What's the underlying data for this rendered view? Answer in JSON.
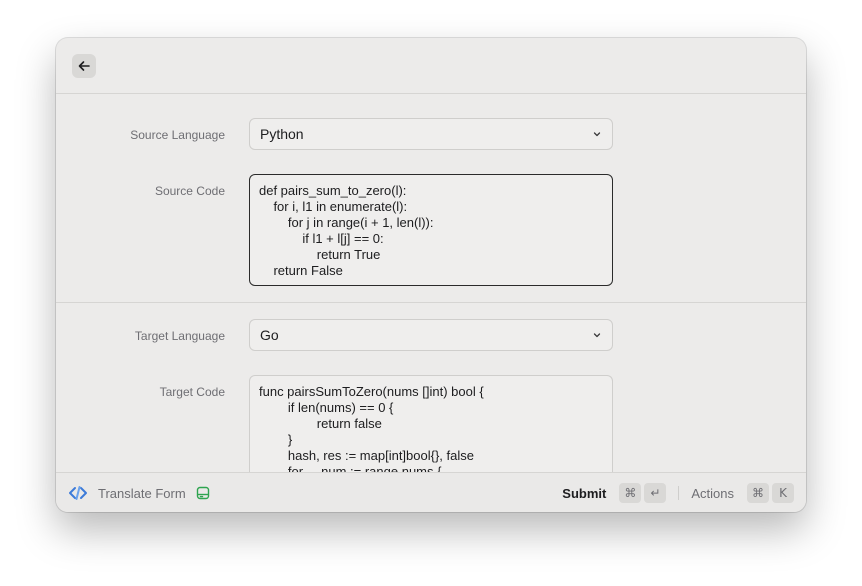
{
  "window": {
    "title": "Translate Form"
  },
  "form": {
    "source_language": {
      "label": "Source Language",
      "value": "Python"
    },
    "source_code": {
      "label": "Source Code",
      "value": "def pairs_sum_to_zero(l):\n    for i, l1 in enumerate(l):\n        for j in range(i + 1, len(l)):\n            if l1 + l[j] == 0:\n                return True\n    return False"
    },
    "target_language": {
      "label": "Target Language",
      "value": "Go"
    },
    "target_code": {
      "label": "Target Code",
      "value": "func pairsSumToZero(nums []int) bool {\n        if len(nums) == 0 {\n                return false\n        }\n        hash, res := map[int]bool{}, false\n        for _, num := range nums {"
    }
  },
  "footer": {
    "command_title": "Translate Form",
    "submit_label": "Submit",
    "submit_keys": [
      "⌘",
      "↵"
    ],
    "actions_label": "Actions",
    "actions_keys": [
      "⌘",
      "K"
    ]
  },
  "icons": {
    "back": "arrow-left-icon",
    "extension": "translate-extension-icon",
    "form": "form-icon",
    "chevron": "chevron-down-icon"
  },
  "colors": {
    "extension_accent": "#3d7bd9",
    "form_icon": "#2ea44f"
  }
}
